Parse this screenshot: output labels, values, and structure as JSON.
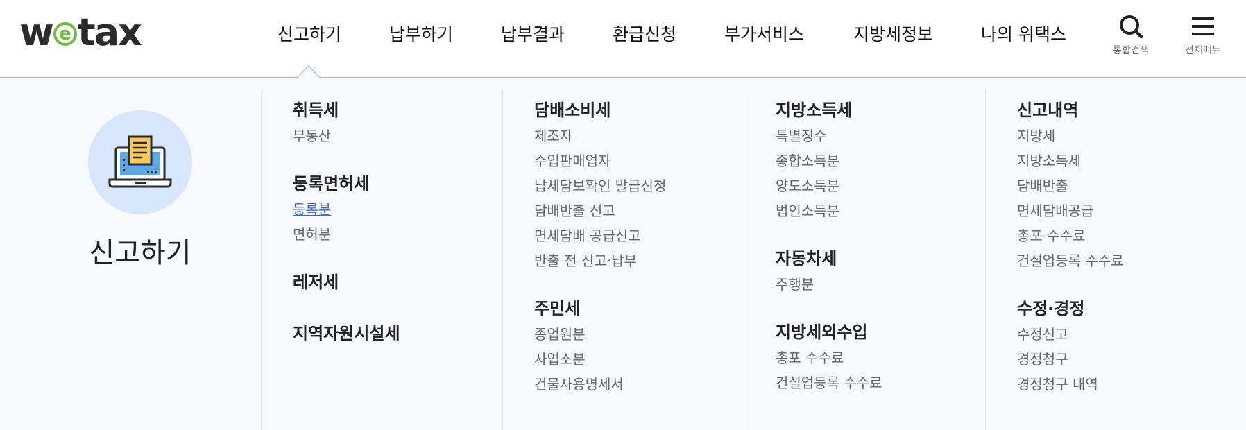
{
  "logo": {
    "w": "w",
    "e": "e",
    "rest": "tax"
  },
  "nav": [
    "신고하기",
    "납부하기",
    "납부결과",
    "환급신청",
    "부가서비스",
    "지방세정보",
    "나의 위택스"
  ],
  "tools": {
    "search_label": "통합검색",
    "menu_label": "전체메뉴"
  },
  "panel": {
    "title": "신고하기",
    "columns": [
      {
        "groups": [
          {
            "title": "취득세",
            "items": [
              "부동산"
            ]
          },
          {
            "title": "등록면허세",
            "items": [
              "등록분",
              "면허분"
            ]
          },
          {
            "title": "레저세",
            "items": []
          },
          {
            "title": "지역자원시설세",
            "items": []
          }
        ]
      },
      {
        "groups": [
          {
            "title": "담배소비세",
            "items": [
              "제조자",
              "수입판매업자",
              "납세담보확인 발급신청",
              "담배반출 신고",
              "면세담배 공급신고",
              "반출 전 신고·납부"
            ]
          },
          {
            "title": "주민세",
            "items": [
              "종업원분",
              "사업소분",
              "건물사용명세서"
            ]
          }
        ]
      },
      {
        "groups": [
          {
            "title": "지방소득세",
            "items": [
              "특별징수",
              "종합소득분",
              "양도소득분",
              "법인소득분"
            ]
          },
          {
            "title": "자동차세",
            "items": [
              "주행분"
            ]
          },
          {
            "title": "지방세외수입",
            "items": [
              "총포 수수료",
              "건설업등록 수수료"
            ]
          }
        ]
      },
      {
        "groups": [
          {
            "title": "신고내역",
            "items": [
              "지방세",
              "지방소득세",
              "담배반출",
              "면세담배공급",
              "총포 수수료",
              "건설업등록 수수료"
            ]
          },
          {
            "title": "수정·경정",
            "items": [
              "수정신고",
              "경정청구",
              "경정청구 내역"
            ]
          }
        ]
      }
    ]
  },
  "colors": {
    "accent_green": "#6cbf3f",
    "link_blue": "#3a67c4",
    "badge_bg": "#d8e6fb"
  }
}
